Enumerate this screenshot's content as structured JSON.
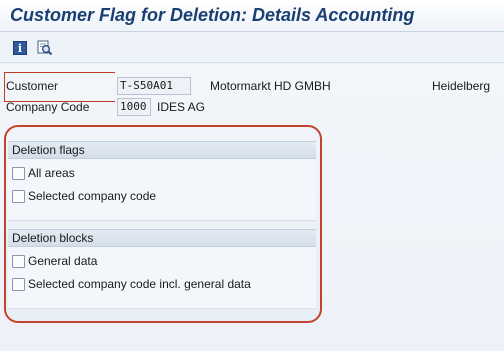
{
  "title": "Customer Flag for Deletion: Details Accounting",
  "toolbar": {
    "info_icon": "info-icon",
    "info_glyph": "i",
    "find_icon": "find-icon"
  },
  "header_fields": {
    "customer": {
      "label": "Customer",
      "value": "T-S50A01",
      "name": "Motormarkt HD GMBH",
      "city": "Heidelberg"
    },
    "company_code": {
      "label": "Company Code",
      "value": "1000",
      "name": "IDES AG"
    }
  },
  "deletion_flags": {
    "title": "Deletion flags",
    "options": [
      {
        "label": "All areas",
        "checked": false
      },
      {
        "label": "Selected company code",
        "checked": false
      }
    ]
  },
  "deletion_blocks": {
    "title": "Deletion blocks",
    "options": [
      {
        "label": "General data",
        "checked": false
      },
      {
        "label": "Selected company code incl. general data",
        "checked": false
      }
    ]
  },
  "colors": {
    "title": "#1b3f73",
    "highlight_frame": "#c0442c",
    "background": "#eef3f9"
  }
}
